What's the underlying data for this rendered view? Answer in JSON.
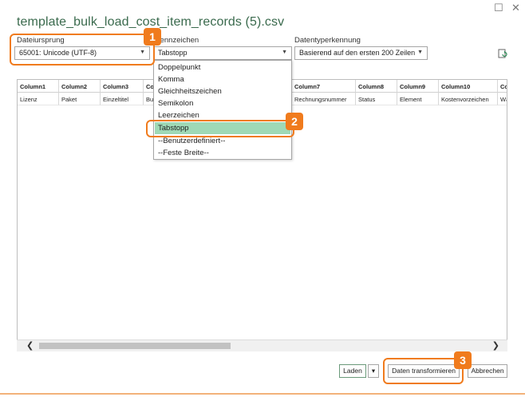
{
  "window": {
    "title": "template_bulk_load_cost_item_records (5).csv",
    "maximize_glyph": "☐",
    "close_glyph": "✕"
  },
  "file_origin": {
    "label": "Dateiursprung",
    "value": "65001: Unicode (UTF-8)"
  },
  "delimiter": {
    "label": "Trennzeichen",
    "value": "Tabstopp",
    "options": [
      "Doppelpunkt",
      "Komma",
      "Gleichheitszeichen",
      "Semikolon",
      "Leerzeichen",
      "Tabstopp",
      "--Benutzerdefiniert--",
      "--Feste Breite--"
    ],
    "selected_index": 5
  },
  "datatype_detection": {
    "label": "Datentyperkennung",
    "value": "Basierend auf den ersten 200 Zeilen"
  },
  "table": {
    "headers": [
      "Column1",
      "Column2",
      "Column3",
      "Co",
      "Column7",
      "Column8",
      "Column9",
      "Column10",
      "Col"
    ],
    "row": [
      "Lizenz",
      "Paket",
      "Einzeltitel",
      "Bu",
      "Rechnungsnummer",
      "Status",
      "Element",
      "Kostenvorzeichen",
      "Wä"
    ]
  },
  "scrollbar": {
    "left_arrow": "❮",
    "right_arrow": "❯"
  },
  "buttons": {
    "load": "Laden",
    "load_menu": "▾",
    "transform": "Daten transformieren",
    "cancel": "Abbrechen"
  },
  "callouts": [
    "1",
    "2",
    "3"
  ],
  "colors": {
    "accent_orange": "#f07b1d",
    "title_green": "#3a6a4d",
    "selected_option": "#9fd9b6"
  }
}
